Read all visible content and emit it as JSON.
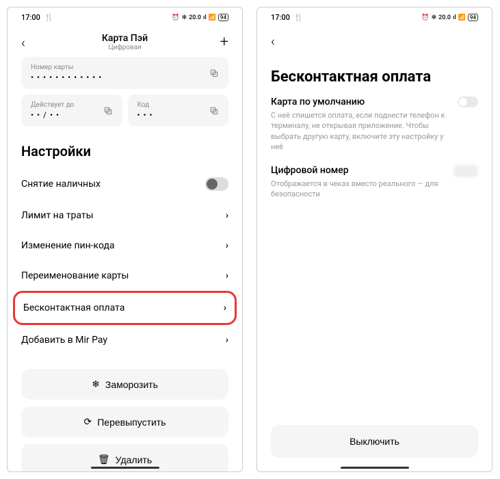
{
  "status": {
    "time": "17:00",
    "icons": "🍴",
    "right": "⏰ ⁂ 20.0 ᵢₗ 📶 🔋94"
  },
  "screen1": {
    "header": {
      "title": "Карта Пэй",
      "subtitle": "Цифровая"
    },
    "card": {
      "number_label": "Номер карты",
      "number_value": "• • • • • • • • • • • •",
      "expiry_label": "Действует до",
      "expiry_value": "• • / • •",
      "code_label": "Код",
      "code_value": "• • •"
    },
    "section_title": "Настройки",
    "settings": [
      {
        "label": "Снятие наличных",
        "type": "toggle"
      },
      {
        "label": "Лимит на траты",
        "type": "link"
      },
      {
        "label": "Изменение пин-кода",
        "type": "link"
      },
      {
        "label": "Переименование карты",
        "type": "link"
      },
      {
        "label": "Бесконтактная оплата",
        "type": "link",
        "highlighted": true
      },
      {
        "label": "Добавить в Mir Pay",
        "type": "link"
      }
    ],
    "actions": {
      "freeze": "Заморозить",
      "reissue": "Перевыпустить",
      "delete": "Удалить"
    }
  },
  "screen2": {
    "title": "Бесконтактная оплата",
    "options": [
      {
        "title": "Карта по умолчанию",
        "desc": "С неё спишется оплата, если поднести телефон к терминалу, не открывая приложение. Чтобы выбрать другую карту, включите эту настройку у неё"
      },
      {
        "title": "Цифровой номер",
        "desc": "Отображается в чеках вместо реального — для безопасности"
      }
    ],
    "bottom_button": "Выключить"
  }
}
